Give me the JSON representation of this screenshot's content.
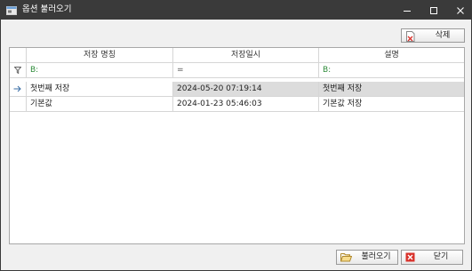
{
  "window": {
    "title": "옵션 불러오기"
  },
  "toolbar": {
    "delete_label": "삭제"
  },
  "grid": {
    "columns": [
      "저장 명칭",
      "저장일시",
      "설명"
    ],
    "filter_row": {
      "name_op": "B:",
      "date_op": "=",
      "desc_op": "B:"
    },
    "rows": [
      {
        "name": "첫번째 저장",
        "saved_at": "2024-05-20 07:19:14",
        "description": "첫번째 저장",
        "selected": true
      },
      {
        "name": "기본값",
        "saved_at": "2024-01-23 05:46:03",
        "description": "기본값 저장",
        "selected": false
      }
    ]
  },
  "footer": {
    "load_label": "불러오기",
    "close_label": "닫기"
  },
  "icons": {
    "title_icon": "window-icon",
    "delete_icon": "document-delete-icon",
    "filter_icon": "funnel-icon",
    "row_indicator": "arrow-right-icon",
    "load_icon": "folder-open-icon",
    "close_icon": "red-x-icon"
  },
  "colors": {
    "titlebar": "#3a3a3a",
    "selected_row": "#dcdcdc",
    "indicator": "#3a6ea5",
    "close_red": "#d9322b"
  }
}
